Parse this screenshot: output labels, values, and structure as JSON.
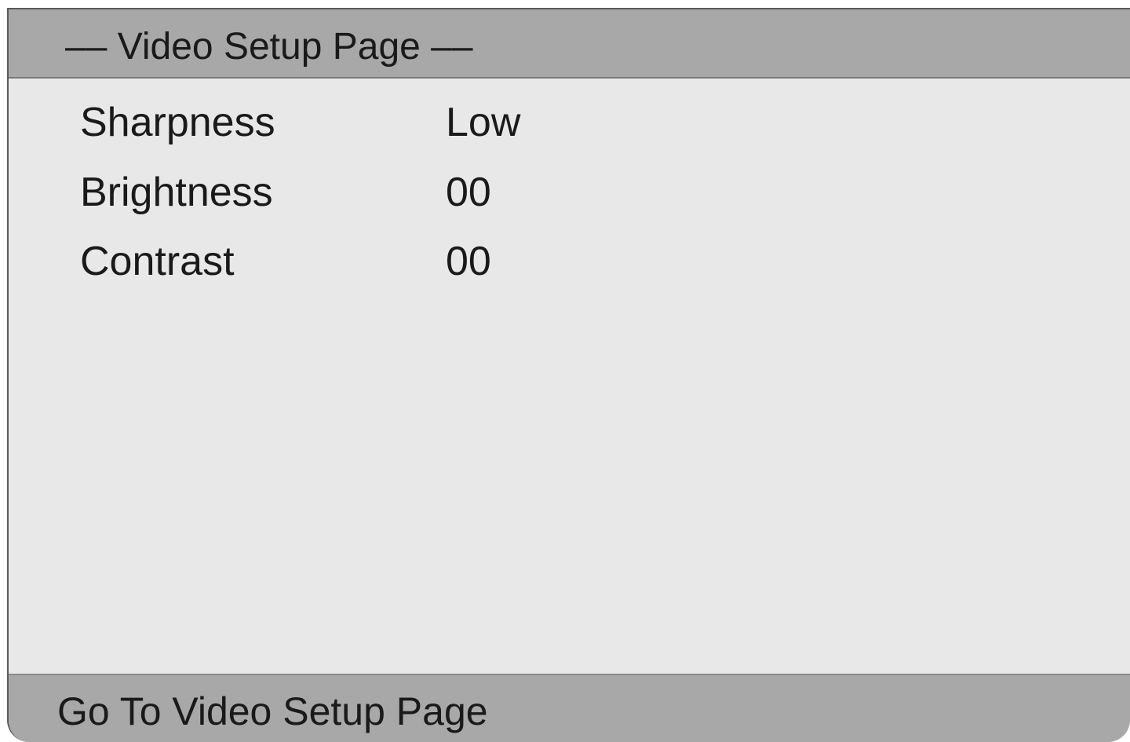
{
  "header": {
    "title": "–– Video Setup Page ––"
  },
  "settings": [
    {
      "label": "Sharpness",
      "value": "Low"
    },
    {
      "label": "Brightness",
      "value": "00"
    },
    {
      "label": "Contrast",
      "value": "00"
    }
  ],
  "footer": {
    "hint": "Go To Video Setup Page"
  },
  "colors": {
    "panel_background": "#e8e8e8",
    "bar_background": "#a8a8a8",
    "text": "#1a1a1a"
  }
}
